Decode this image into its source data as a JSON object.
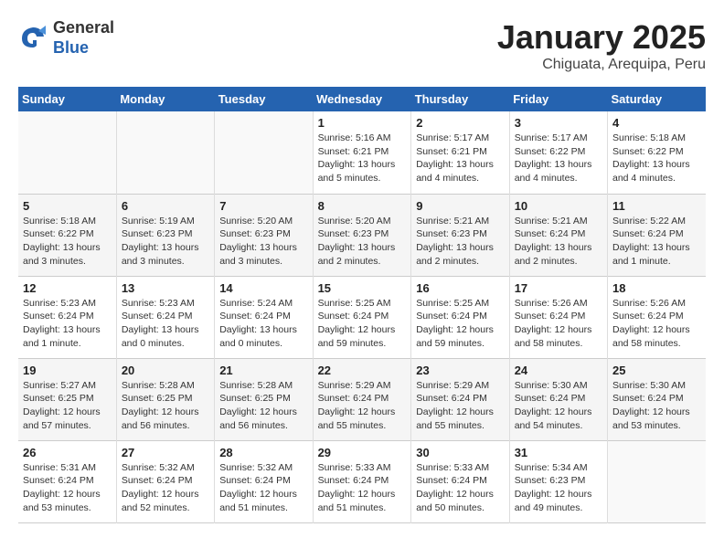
{
  "header": {
    "logo_line1": "General",
    "logo_line2": "Blue",
    "title": "January 2025",
    "subtitle": "Chiguata, Arequipa, Peru"
  },
  "days_of_week": [
    "Sunday",
    "Monday",
    "Tuesday",
    "Wednesday",
    "Thursday",
    "Friday",
    "Saturday"
  ],
  "weeks": [
    [
      {
        "day": "",
        "info": ""
      },
      {
        "day": "",
        "info": ""
      },
      {
        "day": "",
        "info": ""
      },
      {
        "day": "1",
        "info": "Sunrise: 5:16 AM\nSunset: 6:21 PM\nDaylight: 13 hours and 5 minutes."
      },
      {
        "day": "2",
        "info": "Sunrise: 5:17 AM\nSunset: 6:21 PM\nDaylight: 13 hours and 4 minutes."
      },
      {
        "day": "3",
        "info": "Sunrise: 5:17 AM\nSunset: 6:22 PM\nDaylight: 13 hours and 4 minutes."
      },
      {
        "day": "4",
        "info": "Sunrise: 5:18 AM\nSunset: 6:22 PM\nDaylight: 13 hours and 4 minutes."
      }
    ],
    [
      {
        "day": "5",
        "info": "Sunrise: 5:18 AM\nSunset: 6:22 PM\nDaylight: 13 hours and 3 minutes."
      },
      {
        "day": "6",
        "info": "Sunrise: 5:19 AM\nSunset: 6:23 PM\nDaylight: 13 hours and 3 minutes."
      },
      {
        "day": "7",
        "info": "Sunrise: 5:20 AM\nSunset: 6:23 PM\nDaylight: 13 hours and 3 minutes."
      },
      {
        "day": "8",
        "info": "Sunrise: 5:20 AM\nSunset: 6:23 PM\nDaylight: 13 hours and 2 minutes."
      },
      {
        "day": "9",
        "info": "Sunrise: 5:21 AM\nSunset: 6:23 PM\nDaylight: 13 hours and 2 minutes."
      },
      {
        "day": "10",
        "info": "Sunrise: 5:21 AM\nSunset: 6:24 PM\nDaylight: 13 hours and 2 minutes."
      },
      {
        "day": "11",
        "info": "Sunrise: 5:22 AM\nSunset: 6:24 PM\nDaylight: 13 hours and 1 minute."
      }
    ],
    [
      {
        "day": "12",
        "info": "Sunrise: 5:23 AM\nSunset: 6:24 PM\nDaylight: 13 hours and 1 minute."
      },
      {
        "day": "13",
        "info": "Sunrise: 5:23 AM\nSunset: 6:24 PM\nDaylight: 13 hours and 0 minutes."
      },
      {
        "day": "14",
        "info": "Sunrise: 5:24 AM\nSunset: 6:24 PM\nDaylight: 13 hours and 0 minutes."
      },
      {
        "day": "15",
        "info": "Sunrise: 5:25 AM\nSunset: 6:24 PM\nDaylight: 12 hours and 59 minutes."
      },
      {
        "day": "16",
        "info": "Sunrise: 5:25 AM\nSunset: 6:24 PM\nDaylight: 12 hours and 59 minutes."
      },
      {
        "day": "17",
        "info": "Sunrise: 5:26 AM\nSunset: 6:24 PM\nDaylight: 12 hours and 58 minutes."
      },
      {
        "day": "18",
        "info": "Sunrise: 5:26 AM\nSunset: 6:24 PM\nDaylight: 12 hours and 58 minutes."
      }
    ],
    [
      {
        "day": "19",
        "info": "Sunrise: 5:27 AM\nSunset: 6:25 PM\nDaylight: 12 hours and 57 minutes."
      },
      {
        "day": "20",
        "info": "Sunrise: 5:28 AM\nSunset: 6:25 PM\nDaylight: 12 hours and 56 minutes."
      },
      {
        "day": "21",
        "info": "Sunrise: 5:28 AM\nSunset: 6:25 PM\nDaylight: 12 hours and 56 minutes."
      },
      {
        "day": "22",
        "info": "Sunrise: 5:29 AM\nSunset: 6:24 PM\nDaylight: 12 hours and 55 minutes."
      },
      {
        "day": "23",
        "info": "Sunrise: 5:29 AM\nSunset: 6:24 PM\nDaylight: 12 hours and 55 minutes."
      },
      {
        "day": "24",
        "info": "Sunrise: 5:30 AM\nSunset: 6:24 PM\nDaylight: 12 hours and 54 minutes."
      },
      {
        "day": "25",
        "info": "Sunrise: 5:30 AM\nSunset: 6:24 PM\nDaylight: 12 hours and 53 minutes."
      }
    ],
    [
      {
        "day": "26",
        "info": "Sunrise: 5:31 AM\nSunset: 6:24 PM\nDaylight: 12 hours and 53 minutes."
      },
      {
        "day": "27",
        "info": "Sunrise: 5:32 AM\nSunset: 6:24 PM\nDaylight: 12 hours and 52 minutes."
      },
      {
        "day": "28",
        "info": "Sunrise: 5:32 AM\nSunset: 6:24 PM\nDaylight: 12 hours and 51 minutes."
      },
      {
        "day": "29",
        "info": "Sunrise: 5:33 AM\nSunset: 6:24 PM\nDaylight: 12 hours and 51 minutes."
      },
      {
        "day": "30",
        "info": "Sunrise: 5:33 AM\nSunset: 6:24 PM\nDaylight: 12 hours and 50 minutes."
      },
      {
        "day": "31",
        "info": "Sunrise: 5:34 AM\nSunset: 6:23 PM\nDaylight: 12 hours and 49 minutes."
      },
      {
        "day": "",
        "info": ""
      }
    ]
  ]
}
